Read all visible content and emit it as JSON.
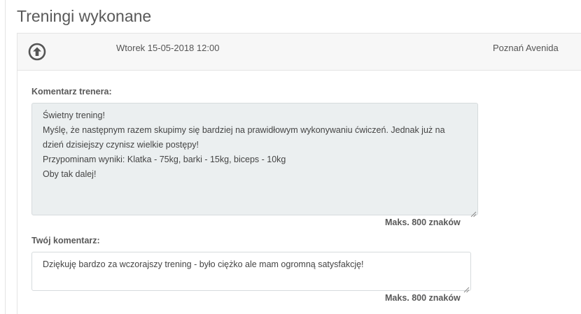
{
  "page": {
    "title": "Treningi wykonane"
  },
  "session": {
    "date": "Wtorek 15-05-2018 12:00",
    "location": "Poznań Avenida",
    "toggle_icon": "arrow-up-circle-icon"
  },
  "trainer_comment": {
    "label": "Komentarz trenera:",
    "lines": [
      "Świetny trening!",
      "Myślę, że następnym razem skupimy się bardziej na prawidłowym wykonywaniu ćwiczeń. Jednak już na",
      "dzień dzisiejszy czynisz wielkie postępy!",
      "Przypominam wyniki: Klatka - 75kg, barki - 15kg, biceps - 10kg",
      "Oby tak dalej!"
    ],
    "max_note": "Maks. 800 znaków"
  },
  "user_comment": {
    "label": "Twój komentarz:",
    "value": "Dziękuję bardzo za wczorajszy trening - było ciężko ale mam ogromną satysfakcję!",
    "max_note": "Maks. 800 znaków"
  },
  "colors": {
    "accent": "#595959",
    "trainer_box_bg": "#ebeff0",
    "header_bg": "#f7f7f7"
  }
}
